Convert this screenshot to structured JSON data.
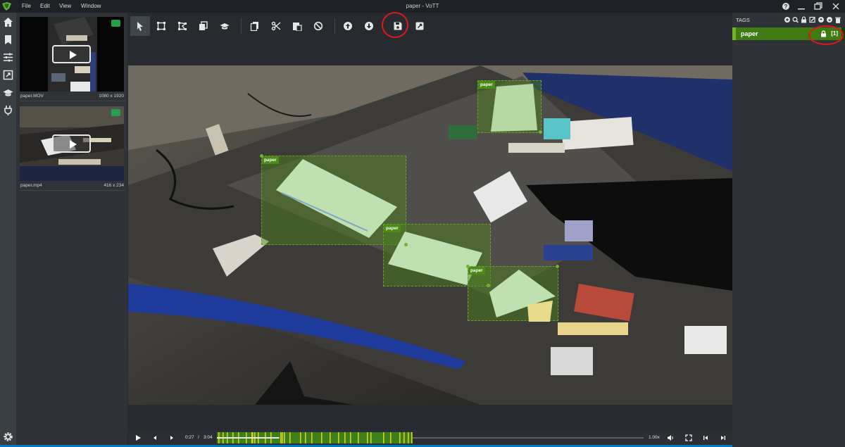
{
  "window": {
    "title": "paper - VoTT",
    "menu": [
      "File",
      "Edit",
      "View",
      "Window"
    ],
    "controls": [
      "help-icon",
      "minimize-icon",
      "restore-icon",
      "close-icon"
    ]
  },
  "left_rail": {
    "items": [
      "home-icon",
      "bookmark-icon",
      "sliders-icon",
      "export-icon",
      "graduation-cap-icon",
      "plug-icon"
    ],
    "footer": "gear-icon"
  },
  "assets": [
    {
      "name": "paper.MOV",
      "size": "1080 x 1920",
      "tagged": true
    },
    {
      "name": "paper.mp4",
      "size": "416 x 234",
      "tagged": true
    }
  ],
  "toolbar": {
    "groups": [
      [
        "select-icon",
        "draw-rectangle-icon",
        "draw-polygon-icon",
        "copy-rectangle-icon",
        "active-learning-icon"
      ],
      [
        "copy-icon",
        "cut-icon",
        "paste-icon",
        "clear-icon"
      ],
      [
        "previous-asset-icon",
        "next-asset-icon",
        "save-icon",
        "export-icon"
      ]
    ]
  },
  "regions": [
    {
      "tag": "paper"
    },
    {
      "tag": "paper"
    },
    {
      "tag": "paper"
    },
    {
      "tag": "paper"
    }
  ],
  "playback": {
    "current_time": "0:27",
    "separator": "/",
    "duration": "3:04",
    "speed": "1.00x",
    "progress_fraction": 0.146
  },
  "tags_panel": {
    "header": "TAGS",
    "actions": [
      "add-icon",
      "search-icon",
      "lock-icon",
      "edit-icon",
      "move-up-icon",
      "move-down-icon",
      "delete-icon"
    ],
    "tags": [
      {
        "name": "paper",
        "hotkey": "[1]",
        "color": "#72b326",
        "locked": true
      }
    ]
  },
  "colors": {
    "accent": "#72b326",
    "region_fill": "#4a861a",
    "annotation_circle": "#e0161b",
    "statusbar": "#0079c1"
  }
}
